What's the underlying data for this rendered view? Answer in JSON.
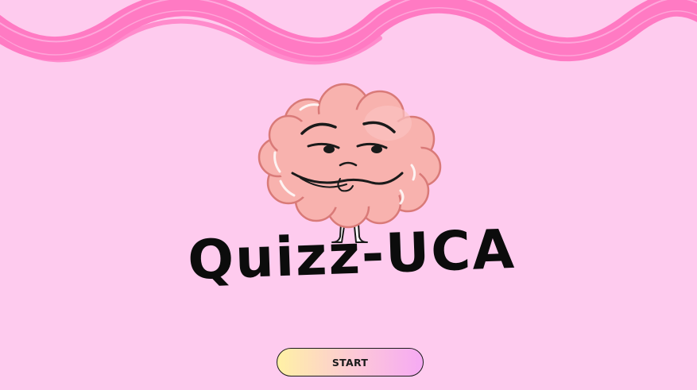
{
  "app": {
    "title": "Quizz-UCA"
  },
  "start_button": {
    "label": "START"
  },
  "icons": {
    "mascot": "brain-mascot-icon",
    "decoration": "pink-wave-brushstroke"
  },
  "colors": {
    "background": "#fecbee",
    "wave": "#ff7ac3",
    "brain": "#f8b2ae",
    "title": "#0c0c0c"
  }
}
